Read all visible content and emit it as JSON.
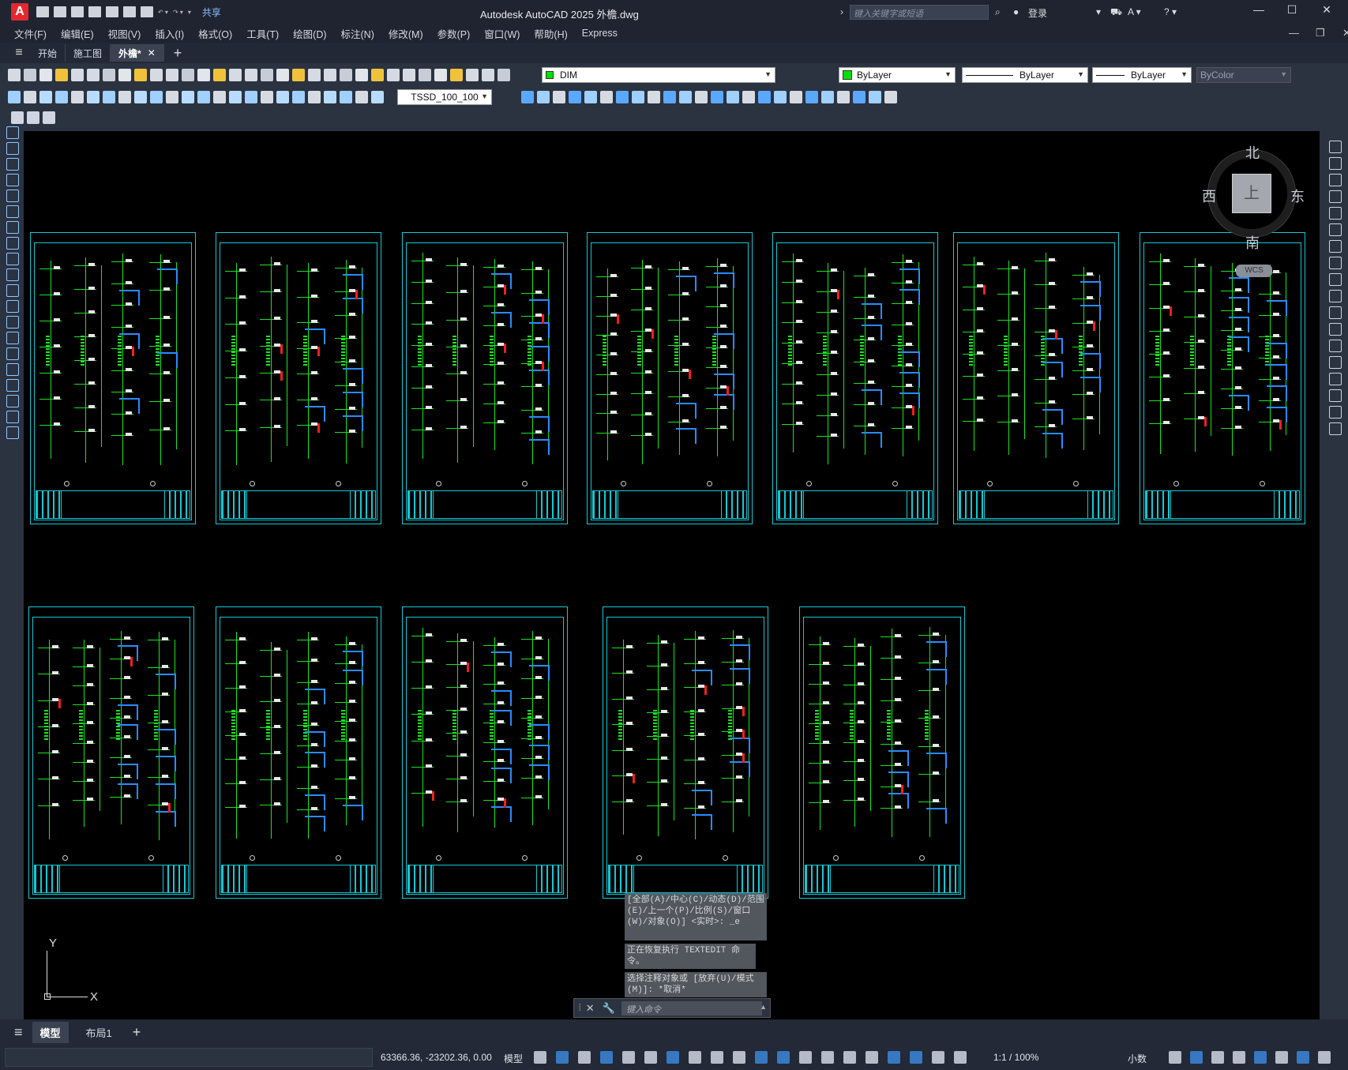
{
  "app": {
    "logo_letter": "A",
    "title": "Autodesk AutoCAD 2025   外檐.dwg",
    "share_label": "共享",
    "search_placeholder": "键入关键字或短语",
    "login_label": "登录"
  },
  "menu": [
    "文件(F)",
    "编辑(E)",
    "视图(V)",
    "插入(I)",
    "格式(O)",
    "工具(T)",
    "绘图(D)",
    "标注(N)",
    "修改(M)",
    "参数(P)",
    "窗口(W)",
    "帮助(H)",
    "Express"
  ],
  "tabs": [
    {
      "label": "开始",
      "active": false
    },
    {
      "label": "施工图",
      "active": false
    },
    {
      "label": "外檐*",
      "active": true
    }
  ],
  "toolbar": {
    "layer_name": "DIM",
    "color_value": "ByLayer",
    "linetype_value": "ByLayer",
    "lineweight_value": "ByLayer",
    "plotstyle_value": "ByColor",
    "dimstyle_value": "TSSD_100_100"
  },
  "viewcube": {
    "north": "北",
    "south": "南",
    "east": "东",
    "west": "西",
    "face": "上",
    "wcs_label": "WCS"
  },
  "ucs": {
    "x_label": "X",
    "y_label": "Y"
  },
  "command_history": [
    "[全部(A)/中心(C)/动态(D)/范围(E)/上一个(P)/比例(S)/窗口(W)/对象(O)] <实时>: _e",
    "正在恢复执行 TEXTEDIT 命令。",
    "选择注释对象或 [放弃(U)/模式(M)]: *取消*"
  ],
  "command_input_placeholder": "键入命令",
  "layout_tabs": [
    {
      "label": "模型",
      "active": true
    },
    {
      "label": "布局1",
      "active": false
    }
  ],
  "status": {
    "coordinates": "63366.36, -23202.36, 0.00",
    "model_label": "模型",
    "scale_label": "1:1 / 100%",
    "units_label": "小数"
  },
  "colors": {
    "sheet_border": "#14c8d6",
    "pipe_green": "#19e51f",
    "pipe_blue": "#2a8cff",
    "accent_red": "#f02020"
  }
}
